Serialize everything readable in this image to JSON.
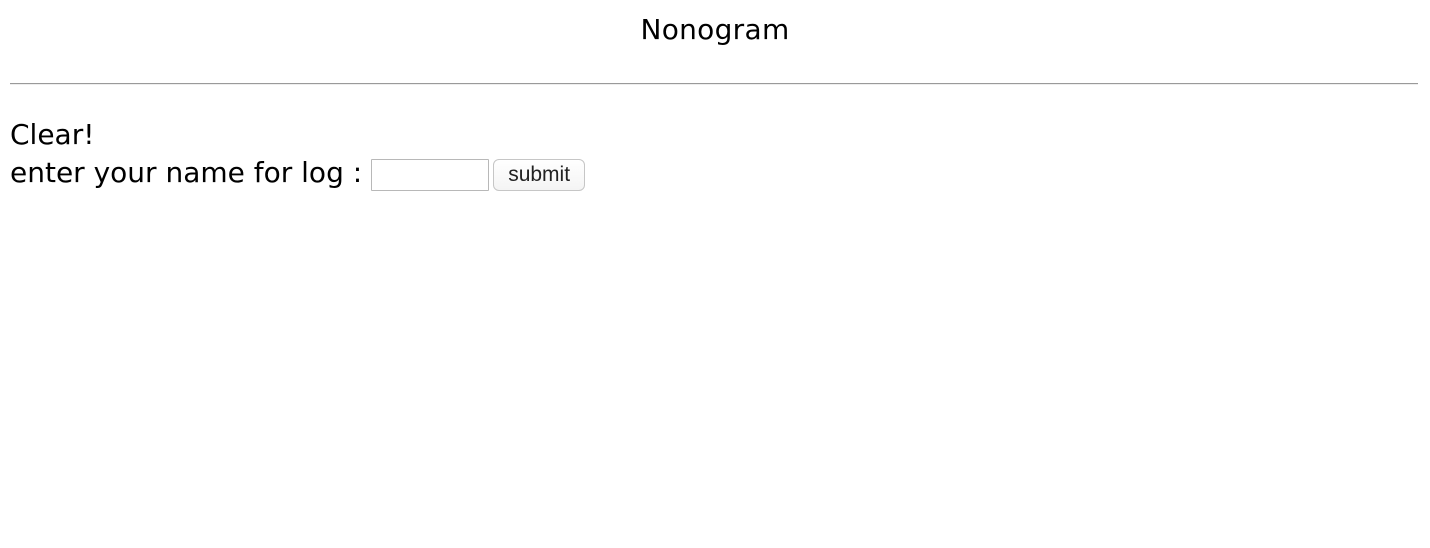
{
  "header": {
    "title": "Nonogram"
  },
  "result": {
    "message": "Clear!"
  },
  "log_form": {
    "label": "enter your name for log :",
    "name_value": "",
    "submit_label": "submit"
  }
}
